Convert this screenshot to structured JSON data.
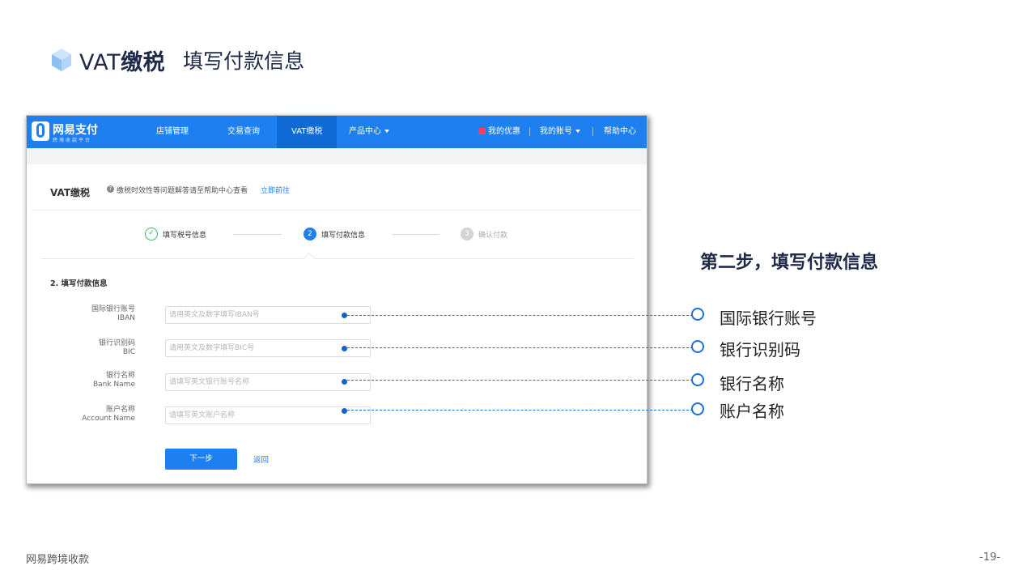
{
  "slide": {
    "title_latin": "VAT",
    "title_bold": "缴税",
    "subtitle": "填写付款信息",
    "step_heading": "第二步，填写付款信息",
    "footer_left": "网易跨境收款",
    "page_number": "-19-"
  },
  "app": {
    "brand": "网易支付",
    "brand_tagline": "跨境收款平台",
    "nav": [
      "店铺管理",
      "交易查询",
      "VAT缴税",
      "产品中心"
    ],
    "nav_active": "VAT缴税",
    "right_links": [
      "我的优惠",
      "我的账号",
      "帮助中心"
    ],
    "colors": {
      "primary": "#1e7ff0",
      "success": "#3cba5a"
    }
  },
  "page": {
    "heading": "VAT缴税",
    "help_text": "缴税时效性等问题解答请至帮助中心查看",
    "help_link": "立即前往",
    "steps": [
      {
        "num": "✓",
        "label": "填写税号信息",
        "status": "done"
      },
      {
        "num": "2",
        "label": "填写付款信息",
        "status": "current"
      },
      {
        "num": "3",
        "label": "确认付款",
        "status": "pending"
      }
    ],
    "section_title": "2. 填写付款信息",
    "fields": [
      {
        "label": "国际银行账号",
        "sublabel": "IBAN",
        "placeholder": "请用英文及数字填写IBAN号"
      },
      {
        "label": "银行识别码",
        "sublabel": "BIC",
        "placeholder": "请用英文及数字填写BIC号"
      },
      {
        "label": "银行名称",
        "sublabel": "Bank Name",
        "placeholder": "请填写英文银行账号名称"
      },
      {
        "label": "账户名称",
        "sublabel": "Account Name",
        "placeholder": "请填写英文账户名称"
      }
    ],
    "next_button": "下一步",
    "back_link": "返回"
  },
  "callouts": [
    "国际银行账号",
    "银行识别码",
    "银行名称",
    "账户名称"
  ]
}
